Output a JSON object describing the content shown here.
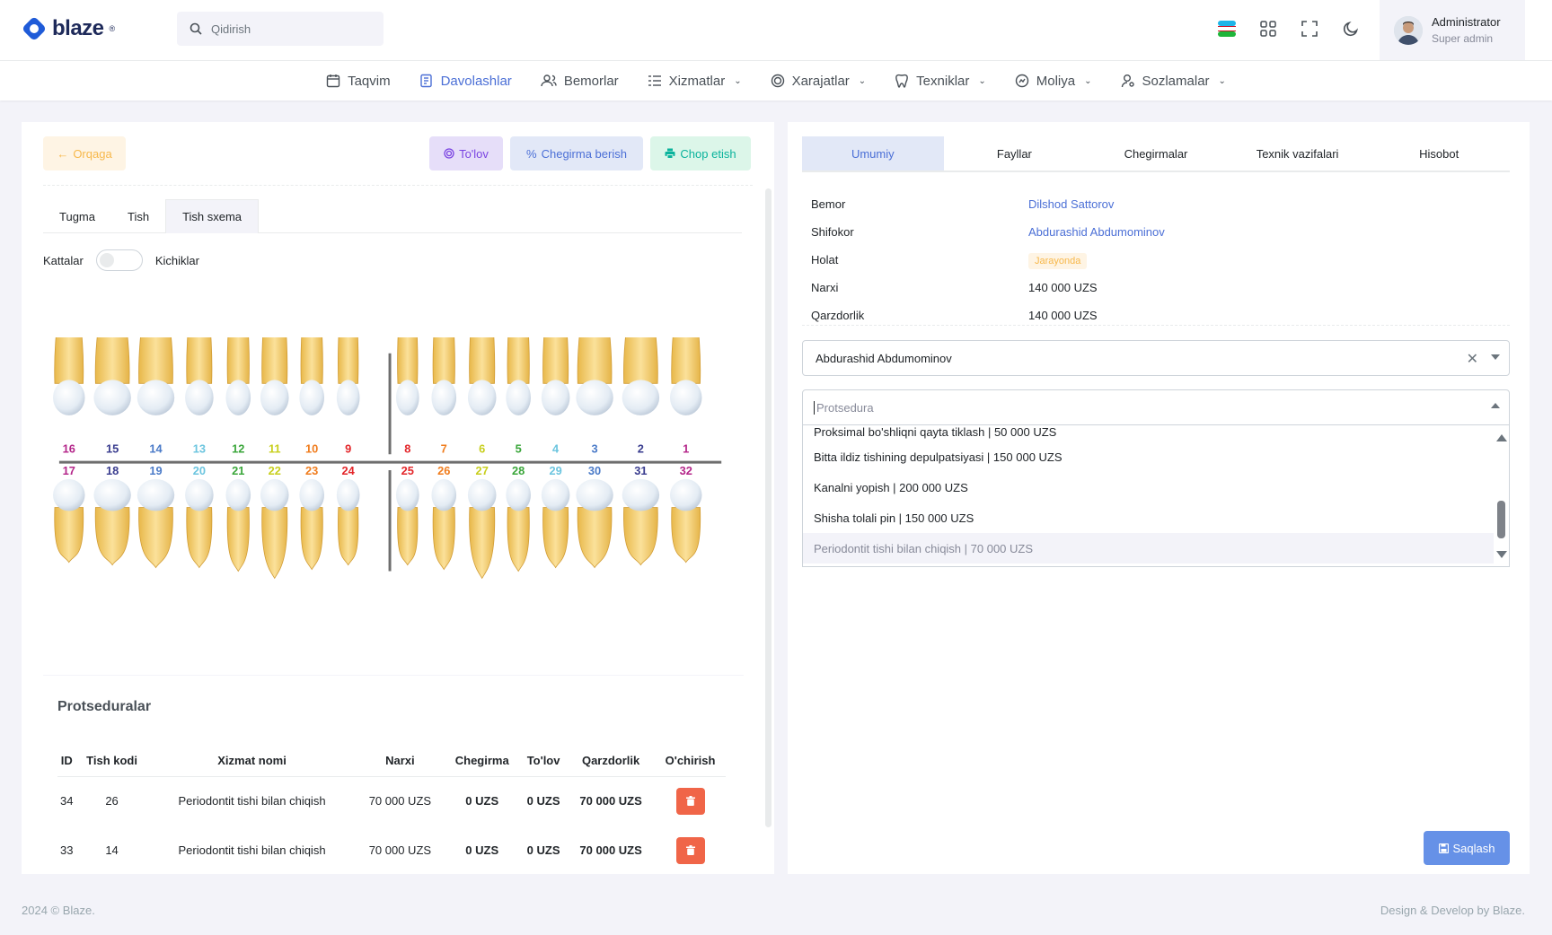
{
  "brand": {
    "name": "blaze",
    "tm": "®"
  },
  "search": {
    "placeholder": "Qidirish"
  },
  "topbar_icons": [
    "uz-flag-icon",
    "apps-grid-icon",
    "fullscreen-icon",
    "dark-mode-icon"
  ],
  "user": {
    "name": "Administrator",
    "role": "Super admin"
  },
  "menu": [
    {
      "label": "Taqvim",
      "icon": "calendar-icon",
      "dropdown": false,
      "active": false
    },
    {
      "label": "Davolashlar",
      "icon": "document-icon",
      "dropdown": false,
      "active": true
    },
    {
      "label": "Bemorlar",
      "icon": "users-icon",
      "dropdown": false,
      "active": false
    },
    {
      "label": "Xizmatlar",
      "icon": "list-icon",
      "dropdown": true,
      "active": false
    },
    {
      "label": "Xarajatlar",
      "icon": "coin-icon",
      "dropdown": true,
      "active": false
    },
    {
      "label": "Texniklar",
      "icon": "tooth-icon",
      "dropdown": true,
      "active": false
    },
    {
      "label": "Moliya",
      "icon": "gauge-icon",
      "dropdown": true,
      "active": false
    },
    {
      "label": "Sozlamalar",
      "icon": "user-gear-icon",
      "dropdown": true,
      "active": false
    }
  ],
  "left": {
    "back_label": "Orqaga",
    "pay_label": "To'lov",
    "discount_label": "Chegirma berish",
    "print_label": "Chop etish",
    "tabs": [
      "Tugma",
      "Tish",
      "Tish sxema"
    ],
    "active_tab": "Tish sxema",
    "switch_left": "Kattalar",
    "switch_right": "Kichiklar",
    "switch_on": false,
    "upper_teeth": [
      "16",
      "15",
      "14",
      "13",
      "12",
      "11",
      "10",
      "9",
      "8",
      "7",
      "6",
      "5",
      "4",
      "3",
      "2",
      "1"
    ],
    "lower_teeth": [
      "17",
      "18",
      "19",
      "20",
      "21",
      "22",
      "23",
      "24",
      "25",
      "26",
      "27",
      "28",
      "29",
      "30",
      "31",
      "32"
    ],
    "upper_colors": [
      "#b4268a",
      "#3a3d8f",
      "#4b7bc8",
      "#6cc5df",
      "#3aa63a",
      "#c8cf1e",
      "#f07d1e",
      "#e3262a",
      "#e3262a",
      "#f07d1e",
      "#c8cf1e",
      "#3aa63a",
      "#6cc5df",
      "#4b7bc8",
      "#3a3d8f",
      "#b4268a"
    ],
    "lower_colors": [
      "#b4268a",
      "#3a3d8f",
      "#4b7bc8",
      "#6cc5df",
      "#3aa63a",
      "#c8cf1e",
      "#f07d1e",
      "#e3262a",
      "#e3262a",
      "#f07d1e",
      "#c8cf1e",
      "#3aa63a",
      "#6cc5df",
      "#4b7bc8",
      "#3a3d8f",
      "#b4268a"
    ]
  },
  "procedures": {
    "title": "Protseduralar",
    "columns": [
      "ID",
      "Tish kodi",
      "Xizmat nomi",
      "Narxi",
      "Chegirma",
      "To'lov",
      "Qarzdorlik",
      "O'chirish"
    ],
    "rows": [
      {
        "id": "34",
        "tooth": "26",
        "service": "Periodontit tishi bilan chiqish",
        "price": "70 000 UZS",
        "discount": "0 UZS",
        "paid": "0 UZS",
        "debt": "70 000 UZS"
      },
      {
        "id": "33",
        "tooth": "14",
        "service": "Periodontit tishi bilan chiqish",
        "price": "70 000 UZS",
        "discount": "0 UZS",
        "paid": "0 UZS",
        "debt": "70 000 UZS"
      }
    ]
  },
  "right": {
    "tabs": [
      "Umumiy",
      "Fayllar",
      "Chegirmalar",
      "Texnik vazifalari",
      "Hisobot"
    ],
    "active_tab": "Umumiy",
    "info": {
      "patient_label": "Bemor",
      "patient": "Dilshod Sattorov",
      "doctor_label": "Shifokor",
      "doctor": "Abdurashid Abdumominov",
      "status_label": "Holat",
      "status": "Jarayonda",
      "price_label": "Narxi",
      "price": "140 000 UZS",
      "debt_label": "Qarzdorlik",
      "debt": "140 000 UZS"
    },
    "doctor_select": "Abdurashid Abdumominov",
    "procedure_placeholder": "Protsedura",
    "options": [
      "Proksimal bo'shliqni qayta tiklash | 50 000 UZS",
      "Bitta ildiz tishining depulpatsiyasi | 150 000 UZS",
      "Kanalni yopish | 200 000 UZS",
      "Shisha tolali pin | 150 000 UZS",
      "Periodontit tishi bilan chiqish | 70 000 UZS"
    ],
    "save_label": "Saqlash"
  },
  "footer": {
    "left": "2024 © Blaze.",
    "right": "Design & Develop by Blaze."
  }
}
